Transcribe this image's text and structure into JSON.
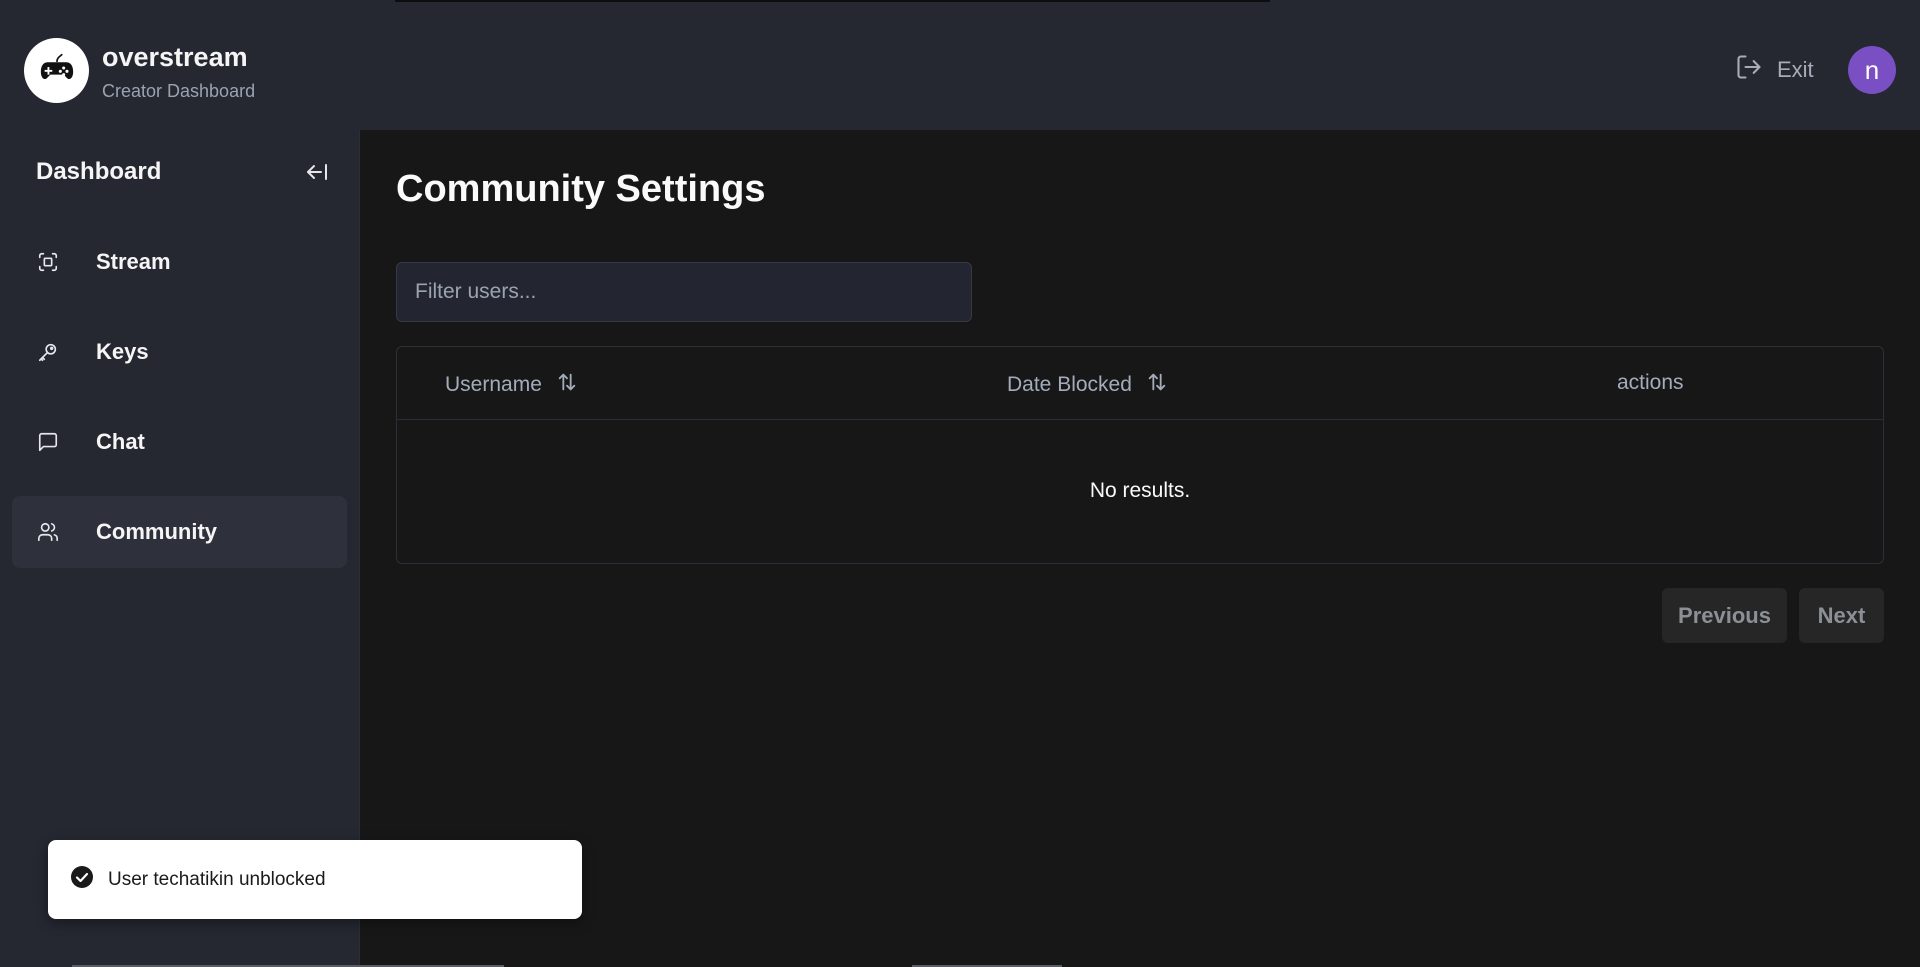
{
  "header": {
    "brand_name": "overstream",
    "brand_subtitle": "Creator Dashboard",
    "exit_label": "Exit",
    "avatar_initial": "n",
    "avatar_color": "#7b4fc4",
    "logo_icon": "gamepad-icon"
  },
  "sidebar": {
    "title": "Dashboard",
    "collapse_icon": "collapse-left-icon",
    "items": [
      {
        "label": "Stream",
        "icon": "scan-icon",
        "active": false
      },
      {
        "label": "Keys",
        "icon": "key-icon",
        "active": false
      },
      {
        "label": "Chat",
        "icon": "chat-icon",
        "active": false
      },
      {
        "label": "Community",
        "icon": "users-icon",
        "active": true
      }
    ]
  },
  "main": {
    "title": "Community Settings",
    "filter": {
      "placeholder": "Filter users...",
      "value": ""
    },
    "table": {
      "columns": [
        {
          "label": "Username",
          "sortable": true
        },
        {
          "label": "Date Blocked",
          "sortable": true
        },
        {
          "label": "actions",
          "sortable": false
        }
      ],
      "rows": [],
      "empty_message": "No results."
    },
    "pagination": {
      "previous_label": "Previous",
      "next_label": "Next"
    }
  },
  "toast": {
    "message": "User techatikin unblocked",
    "icon": "check-circle-icon"
  },
  "colors": {
    "background": "#171717",
    "panel": "#252731",
    "active_nav": "#2e313b",
    "muted_text": "#a3acbb"
  }
}
